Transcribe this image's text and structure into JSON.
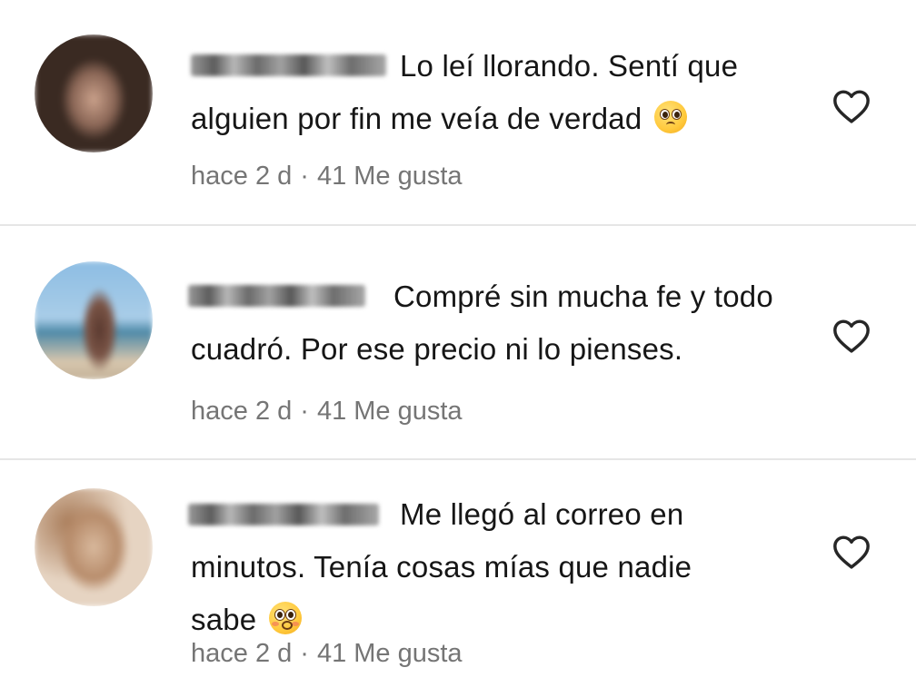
{
  "comments": [
    {
      "text_first": "Lo leí llorando. Sentí que",
      "text_rest": "alguien por fin me veía de verdad",
      "emoji": "pleading-face",
      "time": "hace 2 d",
      "separator": "·",
      "likes": "41 Me gusta",
      "avatar_colors": [
        "#3a2a22",
        "#d2b6a2"
      ]
    },
    {
      "text_first": "Compré sin mucha fe y todo",
      "text_rest": "cuadró. Por ese precio ni lo pienses.",
      "emoji": "",
      "time": "hace 2 d",
      "separator": "·",
      "likes": "41 Me gusta",
      "avatar_colors": [
        "#7fb0d8",
        "#6b4a3e"
      ]
    },
    {
      "text_first": "Me llegó al correo en",
      "text_middle": "minutos. Tenía cosas mías que nadie",
      "text_rest": "sabe",
      "emoji": "flushed-face",
      "time": "hace 2 d",
      "separator": "·",
      "likes": "41 Me gusta",
      "avatar_colors": [
        "#c49a78",
        "#e8d6c4"
      ]
    }
  ],
  "icons": {
    "like": "heart-outline-icon"
  },
  "colors": {
    "text": "#161616",
    "meta": "#757575",
    "divider": "#e6e6e6"
  }
}
